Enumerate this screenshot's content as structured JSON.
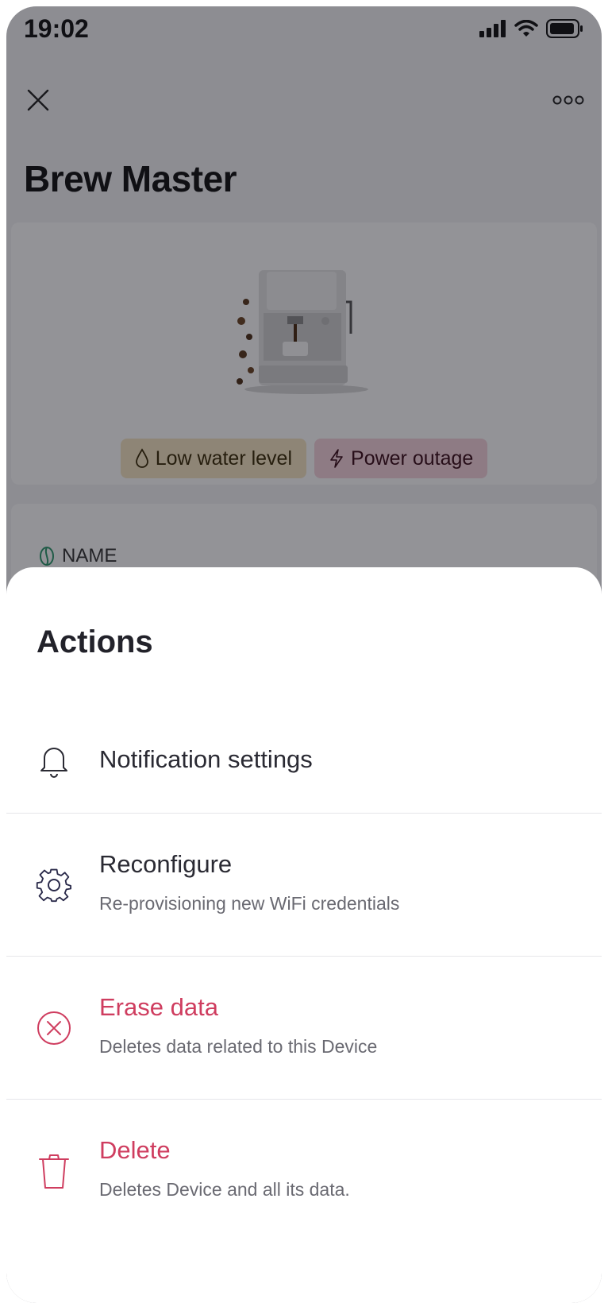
{
  "status_bar": {
    "time": "19:02"
  },
  "header": {
    "title": "Brew Master"
  },
  "device": {
    "badges": [
      {
        "label": "Low water level",
        "icon": "water-drop-icon"
      },
      {
        "label": "Power outage",
        "icon": "lightning-icon"
      }
    ],
    "info": {
      "name_label": "NAME"
    }
  },
  "sheet": {
    "title": "Actions",
    "actions": [
      {
        "title": "Notification settings",
        "icon": "bell-icon"
      },
      {
        "title": "Reconfigure",
        "subtitle": "Re-provisioning new WiFi credentials",
        "icon": "gear-icon"
      },
      {
        "title": "Erase data",
        "subtitle": "Deletes data related to this Device",
        "icon": "erase-circle-x-icon"
      },
      {
        "title": "Delete",
        "subtitle": "Deletes Device and all its data.",
        "icon": "trash-icon"
      }
    ]
  },
  "colors": {
    "danger": "#cf3d5f",
    "badge_water_bg": "#f6e6c4",
    "badge_power_bg": "#f6d3dc"
  }
}
